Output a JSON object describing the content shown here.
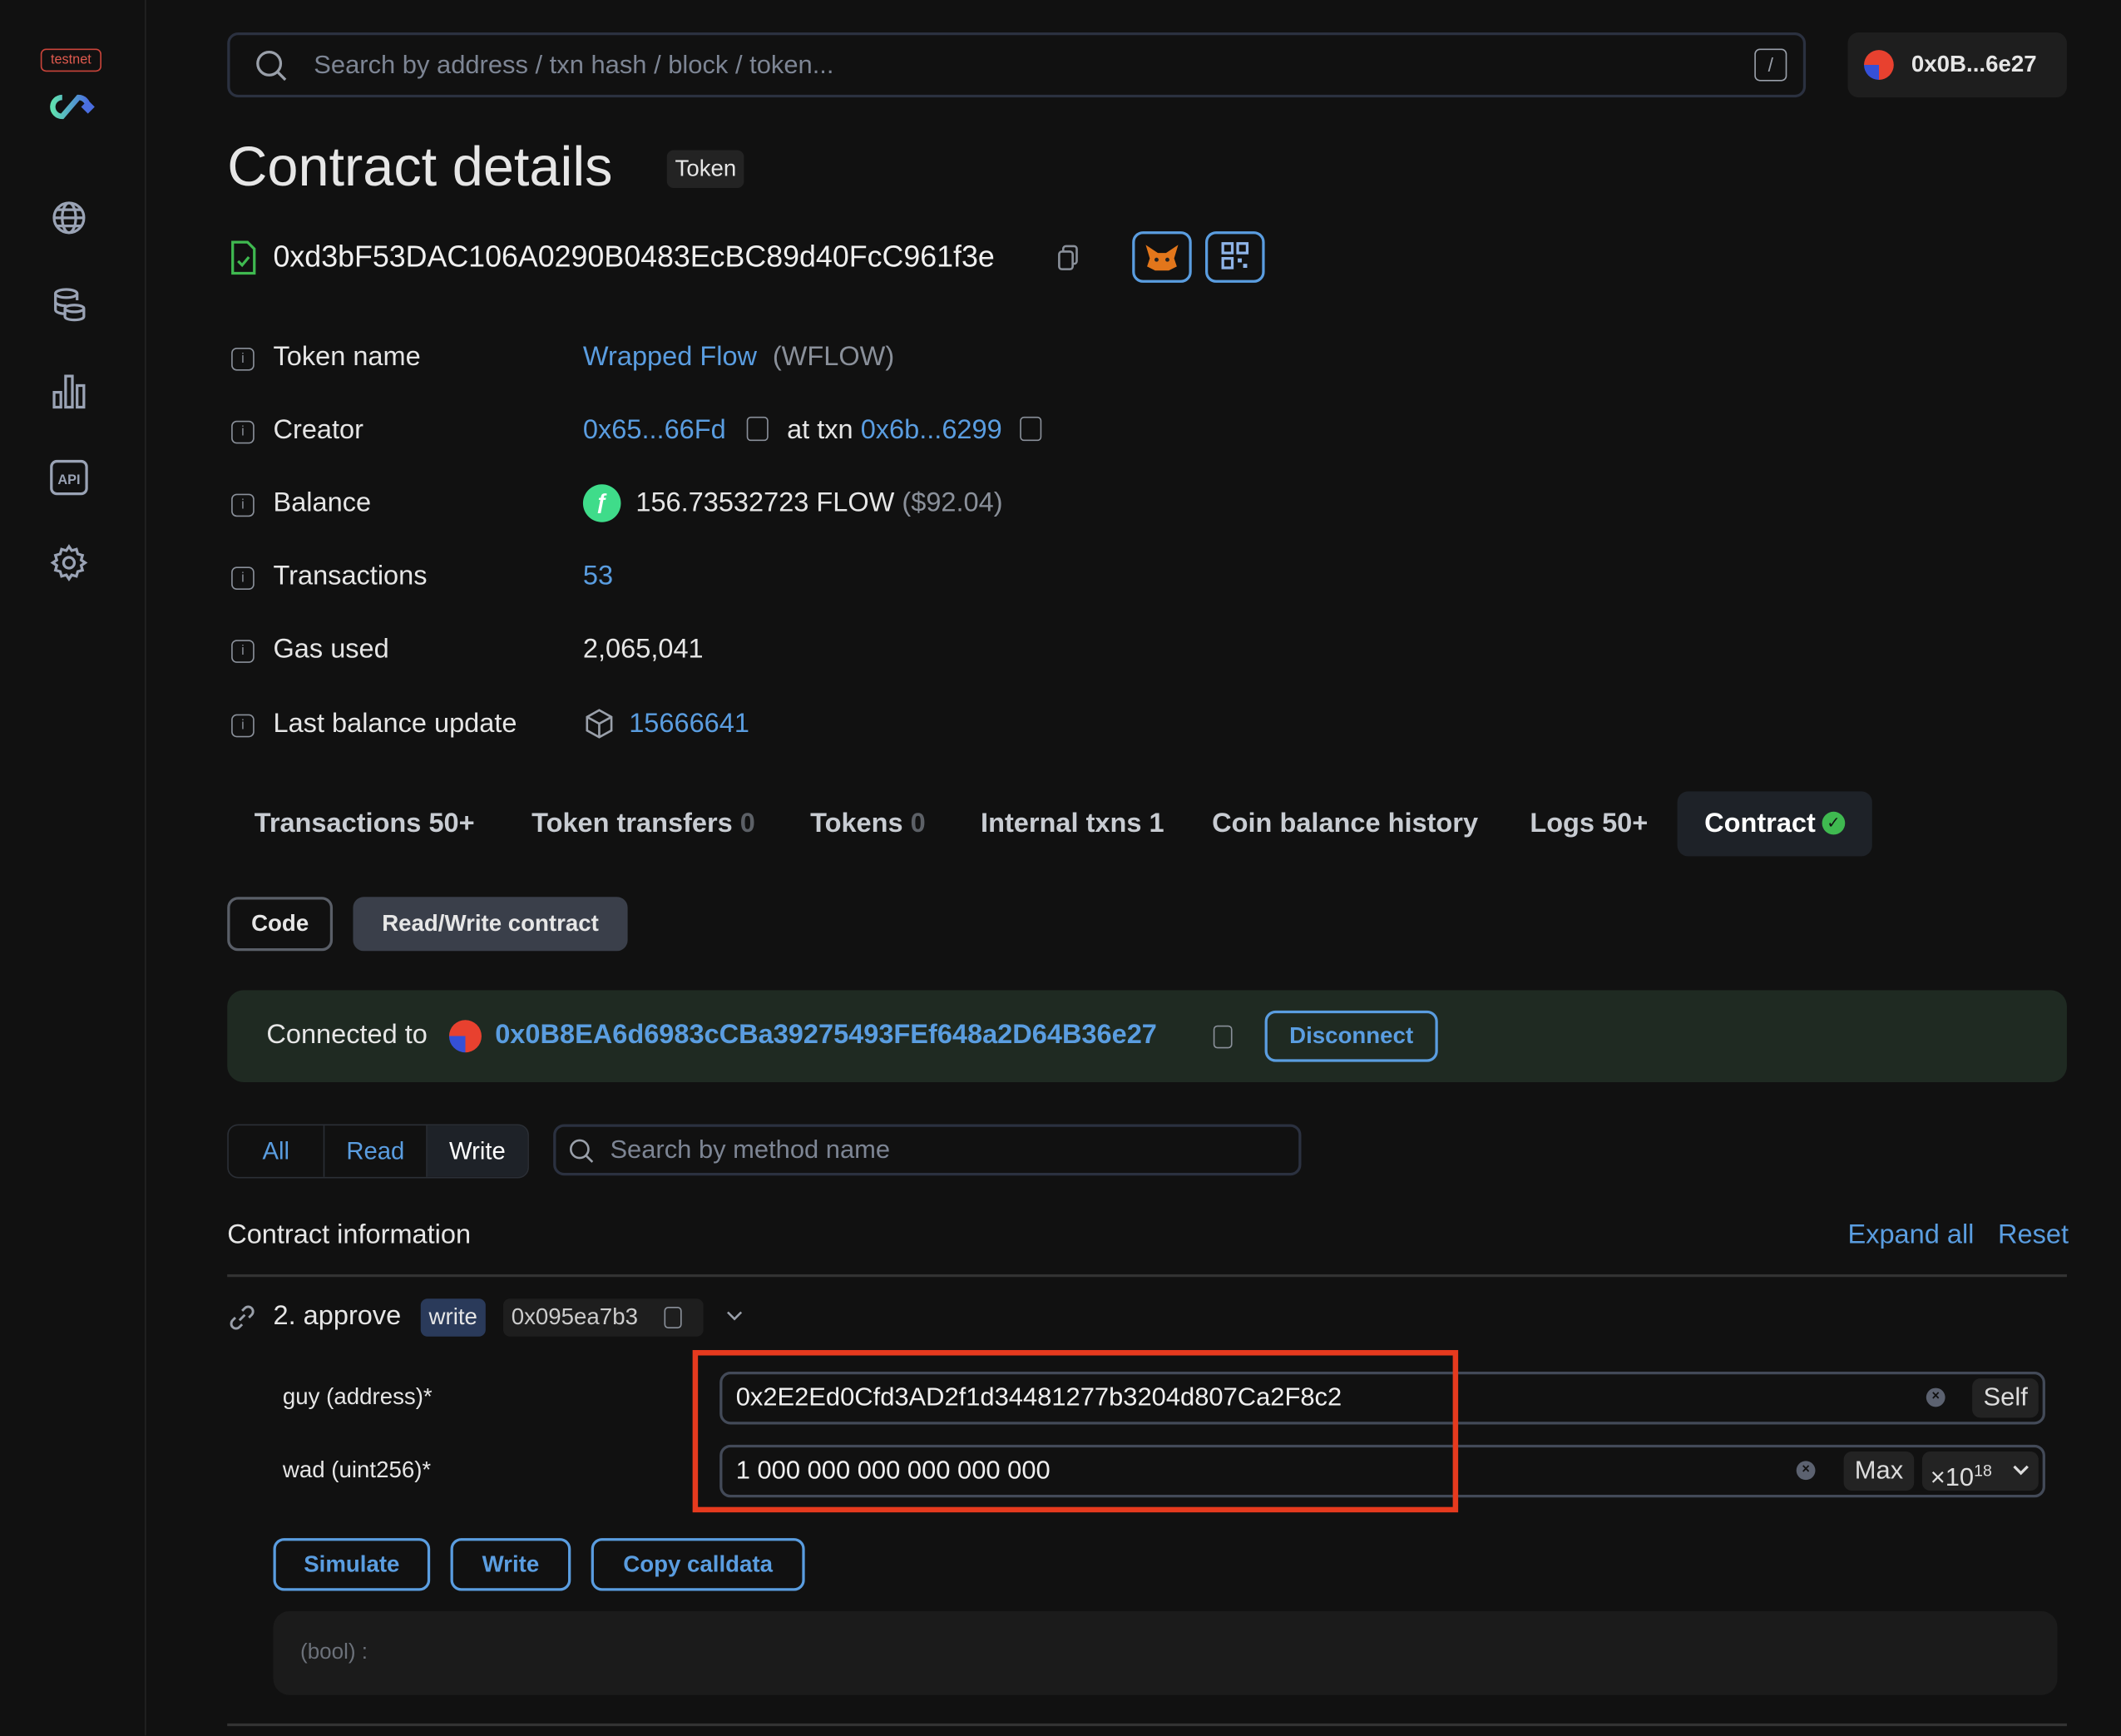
{
  "sidebar": {
    "network_badge": "testnet",
    "icons": [
      "globe-icon",
      "database-icon",
      "bar-chart-icon",
      "api-icon",
      "gear-icon"
    ]
  },
  "header": {
    "search_placeholder": "Search by address / txn hash / block / token...",
    "shortcut": "/",
    "wallet": "0x0B...6e27"
  },
  "page": {
    "title": "Contract details",
    "tag": "Token",
    "address": "0xd3bF53DAC106A0290B0483EcBC89d40FcC961f3e"
  },
  "details": {
    "token_name": {
      "label": "Token name",
      "value": "Wrapped Flow",
      "symbol": "(WFLOW)"
    },
    "creator": {
      "label": "Creator",
      "address": "0x65...66Fd",
      "at_txn": "at txn",
      "txn": "0x6b...6299"
    },
    "balance": {
      "label": "Balance",
      "value": "156.73532723 FLOW",
      "usd": "($92.04)"
    },
    "transactions": {
      "label": "Transactions",
      "value": "53"
    },
    "gas_used": {
      "label": "Gas used",
      "value": "2,065,041"
    },
    "last_balance_update": {
      "label": "Last balance update",
      "value": "15666641"
    }
  },
  "tabs": [
    {
      "label": "Transactions",
      "count": "50+"
    },
    {
      "label": "Token transfers",
      "count": "0"
    },
    {
      "label": "Tokens",
      "count": "0"
    },
    {
      "label": "Internal txns",
      "count": "1"
    },
    {
      "label": "Coin balance history",
      "count": ""
    },
    {
      "label": "Logs",
      "count": "50+"
    },
    {
      "label": "Contract",
      "count": "",
      "active": true
    }
  ],
  "subtabs": {
    "code": "Code",
    "rw": "Read/Write contract"
  },
  "connection": {
    "label": "Connected to",
    "address": "0x0B8EA6d6983cCBa39275493FEf648a2D64B36e27",
    "disconnect": "Disconnect"
  },
  "filter": {
    "all": "All",
    "read": "Read",
    "write": "Write",
    "search_placeholder": "Search by method name"
  },
  "contract_info": {
    "title": "Contract information",
    "expand_all": "Expand all",
    "reset": "Reset"
  },
  "method": {
    "name": "2. approve",
    "type": "write",
    "selector": "0x095ea7b3",
    "inputs": [
      {
        "label": "guy (address)*",
        "value": "0x2E2Ed0Cfd3AD2f1d34481277b3204d807Ca2F8c2",
        "button": "Self"
      },
      {
        "label": "wad (uint256)*",
        "value": "1 000 000 000 000 000 000",
        "button": "Max",
        "multiplier": "×10",
        "exponent": "18"
      }
    ],
    "actions": {
      "simulate": "Simulate",
      "write": "Write",
      "copy": "Copy calldata"
    },
    "result": "(bool) :"
  },
  "colors": {
    "accent": "#5a9de0",
    "highlight_box": "#e63a1e",
    "banner": "#1f2a22",
    "verified": "#3fb950"
  }
}
